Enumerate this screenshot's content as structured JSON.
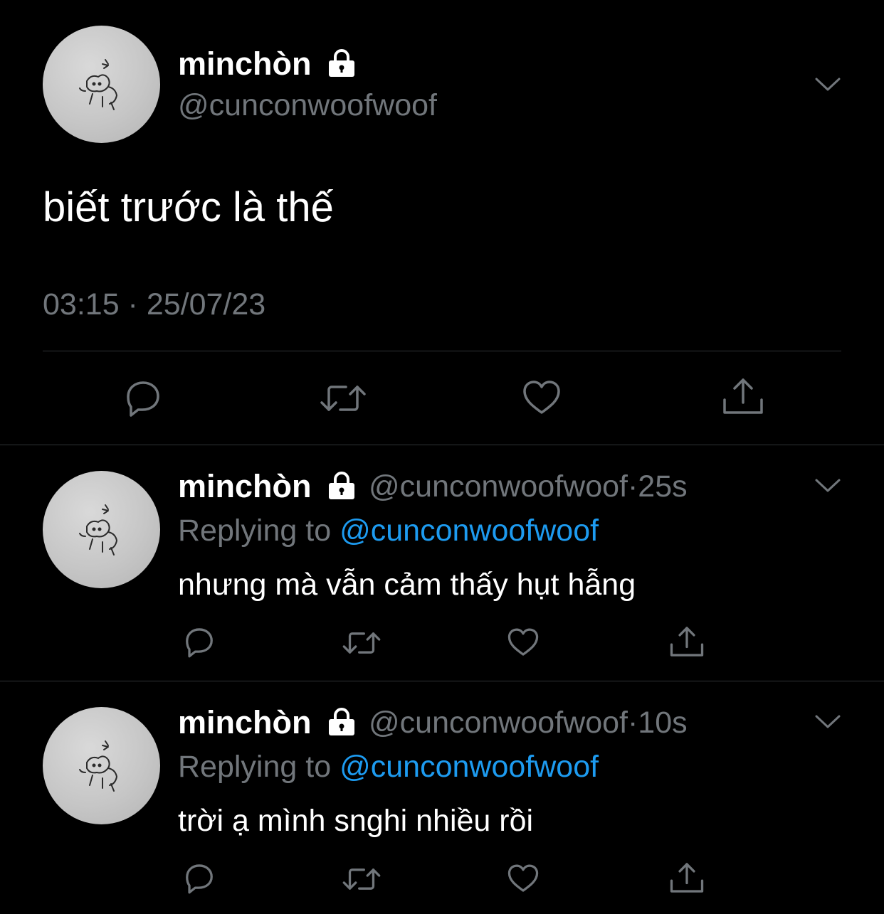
{
  "colors": {
    "background": "#000000",
    "text": "#ffffff",
    "muted": "#71767b",
    "link": "#1d9bf0",
    "divider": "#2f3336"
  },
  "main_tweet": {
    "display_name": "minchòn",
    "handle": "@cunconwoofwoof",
    "text": "biết trước là thế",
    "timestamp": "03:15 · 25/07/23",
    "icons": [
      "lock-icon",
      "chevron-down-icon",
      "reply-icon",
      "retweet-icon",
      "like-icon",
      "share-icon"
    ]
  },
  "replies": [
    {
      "display_name": "minchòn",
      "handle": "@cunconwoofwoof",
      "separator": "·",
      "time": "25s",
      "replying_label": "Replying to",
      "replying_to": "@cunconwoofwoof",
      "text": "nhưng mà vẫn cảm thấy hụt hẫng"
    },
    {
      "display_name": "minchòn",
      "handle": "@cunconwoofwoof",
      "separator": "·",
      "time": "10s",
      "replying_label": "Replying to",
      "replying_to": "@cunconwoofwoof",
      "text": "trời ạ mình snghi nhiều rồi"
    }
  ]
}
